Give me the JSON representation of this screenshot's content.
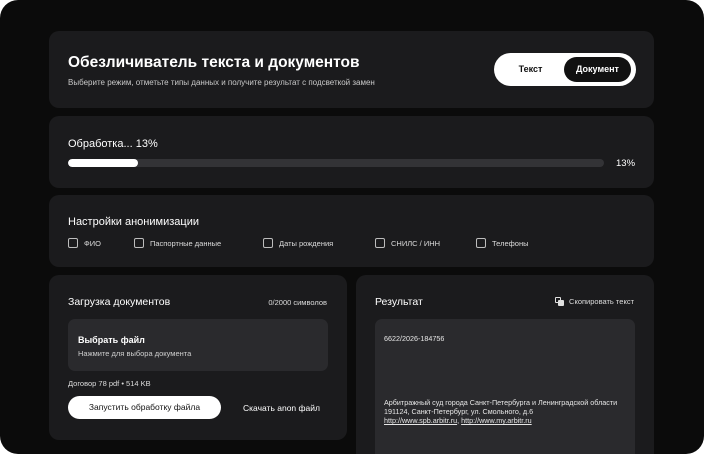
{
  "header": {
    "title": "Обезличиватель текста и документов",
    "subtitle": "Выберите режим, отметьте типы данных и получите результат с подсветкой замен",
    "mode_text": "Текст",
    "mode_document": "Документ",
    "active_mode": "Документ"
  },
  "progress": {
    "label": "Обработка... 13%",
    "percent_label": "13%",
    "value": 0.13
  },
  "settings": {
    "title": "Настройки анонимизации",
    "options": [
      {
        "label": "ФИО",
        "checked": false
      },
      {
        "label": "Паспортные данные",
        "checked": false
      },
      {
        "label": "Даты рождения",
        "checked": false
      },
      {
        "label": "СНИЛС / ИНН",
        "checked": false
      },
      {
        "label": "Телефоны",
        "checked": false
      }
    ]
  },
  "upload": {
    "title": "Загрузка документов",
    "counter": "0/2000 символов",
    "dropzone_title": "Выбрать файл",
    "dropzone_hint": "Нажмите для выбора документа",
    "file_info": "Договор 78 pdf • 514 KB",
    "start_button": "Запустить обработку файла",
    "download_button": "Скачать anon файл"
  },
  "result": {
    "title": "Результат",
    "copy_label": "Скопировать текст",
    "line1": "6622/2026-184756",
    "line2": "Арбитражный суд города Санкт-Петербурга и Ленинградской области",
    "line3": "191124, Санкт-Петербург, ул. Смольного, д.6",
    "link1": "http://www.spb.arbitr.ru",
    "link_sep": ",",
    "link2": "http://www.my.arbitr.ru"
  },
  "colors": {
    "background": "#0b0b0b",
    "card": "#1b1b1d",
    "inner": "#2a2a2d",
    "accent": "#ffffff"
  }
}
